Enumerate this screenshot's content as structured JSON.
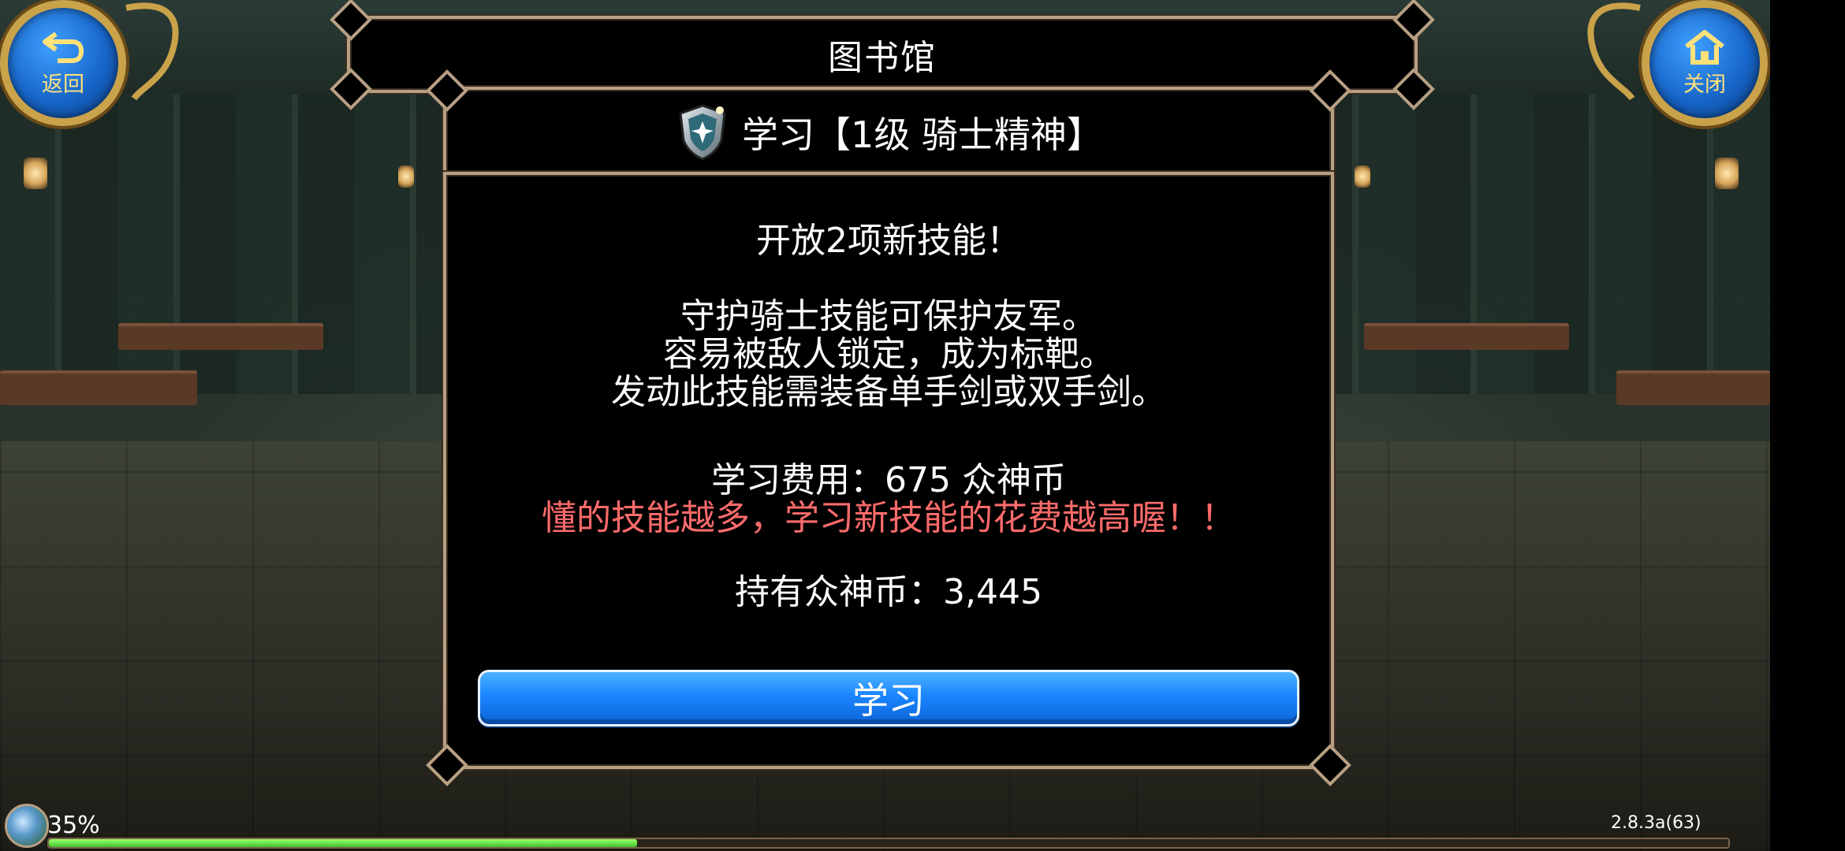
{
  "header": {
    "title": "图书馆"
  },
  "nav": {
    "back_label": "返回",
    "close_label": "关闭",
    "back_icon": "return-arrow-icon",
    "close_icon": "home-icon"
  },
  "skill": {
    "heading": "学习【1级  骑士精神】",
    "icon": "shield-icon"
  },
  "content": {
    "unlock_text": "开放2项新技能！",
    "description": [
      "守护骑士技能可保护友军。",
      "容易被敌人锁定，成为标靶。",
      "发动此技能需装备单手剑或双手剑。"
    ],
    "cost_text": "学习费用：675 众神币",
    "warning_text": "懂的技能越多，学习新技能的花费越高喔！！",
    "owned_text": "持有众神币：3,445"
  },
  "actions": {
    "learn_label": "学习"
  },
  "status": {
    "loading_percent": "35%",
    "progress": 0.35,
    "version": "2.8.3a(63)"
  },
  "colors": {
    "accent_blue": "#1a86ff",
    "warning_red": "#ff6b6b",
    "frame_gold": "#b8a084",
    "button_gold": "#c9a24a"
  }
}
